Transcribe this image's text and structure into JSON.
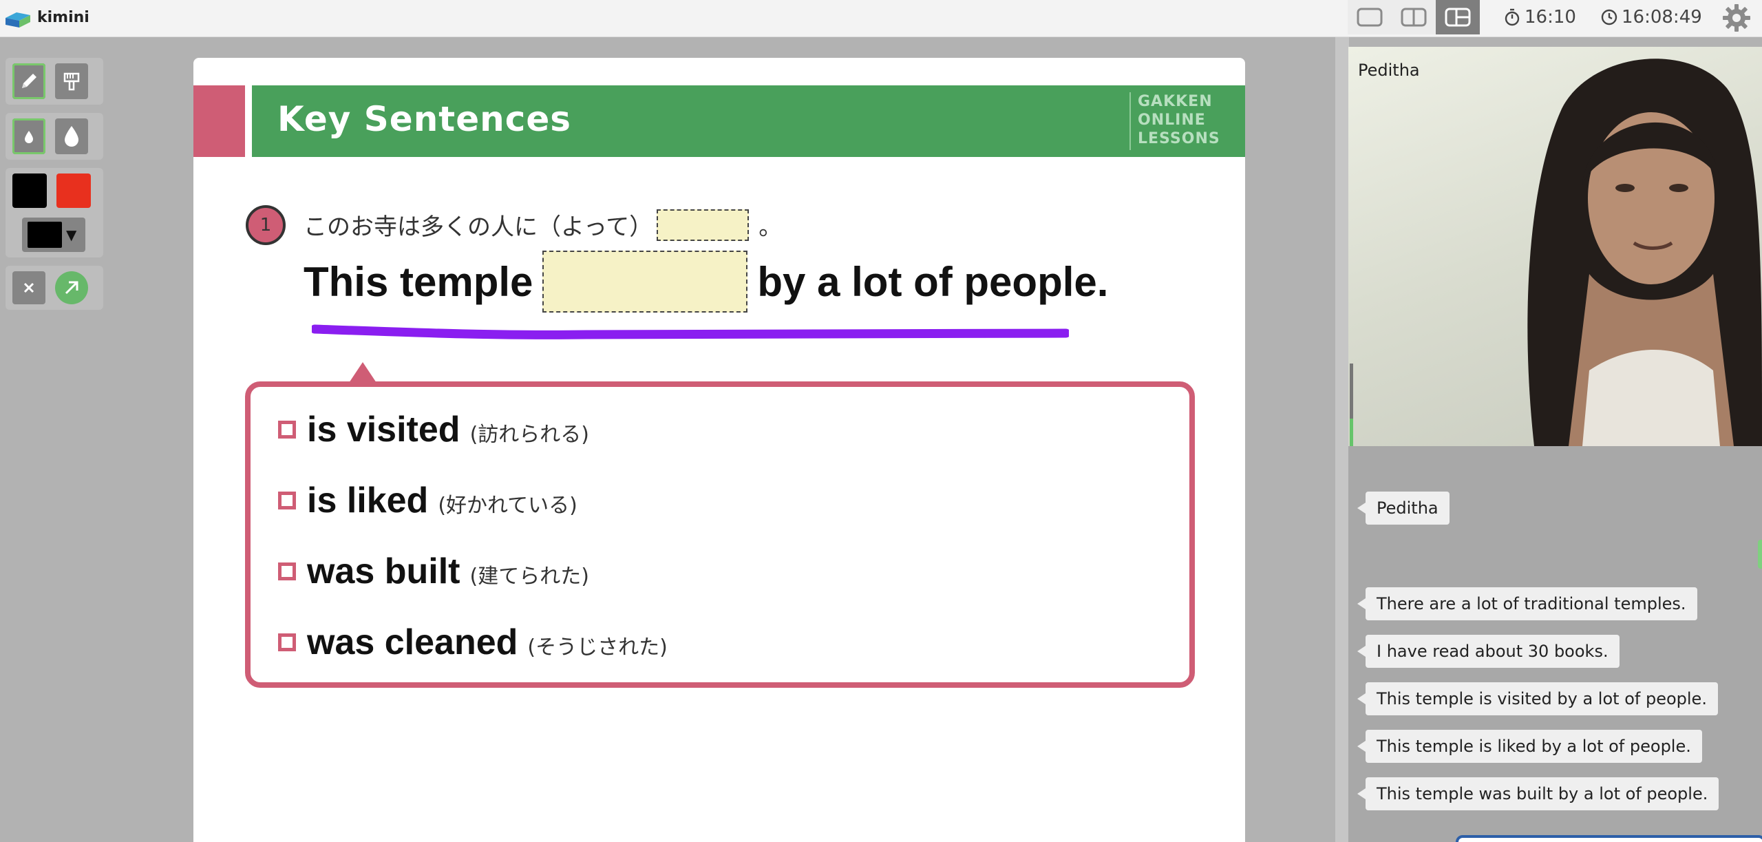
{
  "app": {
    "name": "kimini"
  },
  "header": {
    "timer": "16:10",
    "clock": "16:08:49"
  },
  "slide": {
    "title": "Key Sentences",
    "brand_lines": [
      "GAKKEN",
      "ONLINE",
      "LESSONS"
    ],
    "number": "1",
    "jp_prompt_before": "このお寺は多くの人に（よって）",
    "jp_prompt_after": "。",
    "en_before": "This temple",
    "en_after": "by a lot of people.",
    "options": [
      {
        "en": "is visited",
        "jp": "(訪れられる)"
      },
      {
        "en": "is liked",
        "jp": "(好かれている)"
      },
      {
        "en": "was built",
        "jp": "(建てられた)"
      },
      {
        "en": "was cleaned",
        "jp": "(そうじされた)"
      }
    ]
  },
  "colors": {
    "banner_green": "#49a05b",
    "accent_pink": "#cf5d75",
    "blank_fill": "#f6f2c6",
    "pen_purple": "#8a1ef0",
    "swatch_black": "#000000",
    "swatch_red": "#e8301e"
  },
  "video": {
    "name": "Peditha"
  },
  "chat": {
    "messages": [
      "Peditha",
      "There are a lot of traditional temples.",
      "I have read about 30 books.",
      "This temple is visited by a lot of people.",
      "This temple is liked by a lot of people.",
      "This temple was built by a lot of people."
    ]
  }
}
